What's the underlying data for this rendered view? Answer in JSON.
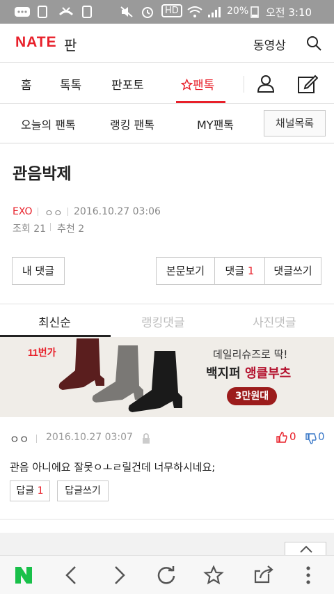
{
  "status_bar": {
    "battery_percent": "20%",
    "time": "오전 3:10",
    "hd_label": "HD"
  },
  "header": {
    "logo": "NATE",
    "logo_sub": "판",
    "video_link": "동영상"
  },
  "gnb": {
    "items": [
      "홈",
      "톡톡",
      "판포토",
      "팬톡"
    ],
    "active_index": 3
  },
  "subnav": {
    "items": [
      "오늘의 팬톡",
      "랭킹 팬톡",
      "MY팬톡"
    ],
    "channel_button": "채널목록"
  },
  "post": {
    "title": "관음박제",
    "channel": "EXO",
    "author": "ㅇㅇ",
    "date": "2016.10.27 03:06",
    "views_label": "조회 21",
    "recommend_label": "추천 2"
  },
  "actions": {
    "my_comments": "내 댓글",
    "view_post": "본문보기",
    "comments_label": "댓글",
    "comments_count": "1",
    "write_comment": "댓글쓰기"
  },
  "comment_tabs": {
    "items": [
      "최신순",
      "랭킹댓글",
      "사진댓글"
    ],
    "active_index": 0
  },
  "ad": {
    "brand": "11번가",
    "line1": "데일리슈즈로 딱!",
    "line2_part1": "백지퍼 ",
    "line2_part2": "앵클부츠",
    "badge": "3만원대"
  },
  "comment": {
    "author": "ㅇㅇ",
    "date": "2016.10.27 03:07",
    "text": "관음 아니에요 잘못ㅇㅗㄹ릴건데 너무하시네요;",
    "likes": "0",
    "dislikes": "0",
    "reply_label": "답글",
    "reply_count": "1",
    "write_reply": "답글쓰기"
  },
  "colors": {
    "accent": "#e8202a",
    "status_bar": "#9a9a9a"
  },
  "icons": [
    "search-icon",
    "user-icon",
    "edit-icon",
    "star-icon",
    "lock-icon",
    "thumbs-up-icon",
    "thumbs-down-icon",
    "scroll-top-icon",
    "naver-icon",
    "back-icon",
    "forward-icon",
    "refresh-icon",
    "bookmark-star-icon",
    "share-icon",
    "more-icon"
  ]
}
